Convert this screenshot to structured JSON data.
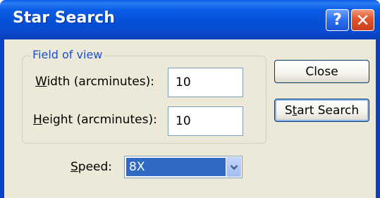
{
  "window": {
    "title": "Star Search",
    "help_label": "?",
    "close_label": "✕"
  },
  "field_of_view": {
    "group_label": "Field of view",
    "width_label_mnemonic": "W",
    "width_label_rest": "idth (arcminutes):",
    "width_value": "10",
    "height_label_mnemonic": "H",
    "height_label_rest": "eight (arcminutes):",
    "height_value": "10"
  },
  "buttons": {
    "close_label": "Close",
    "start_search_prefix": "S",
    "start_search_mnemonic": "t",
    "start_search_rest": "art Search"
  },
  "speed": {
    "label_mnemonic": "S",
    "label_rest": "peed:",
    "value": "8X"
  },
  "colors": {
    "titlebar": "#0a5de6",
    "client": "#ece9d8",
    "selection": "#316ac5",
    "group_label": "#1f4fc4"
  }
}
